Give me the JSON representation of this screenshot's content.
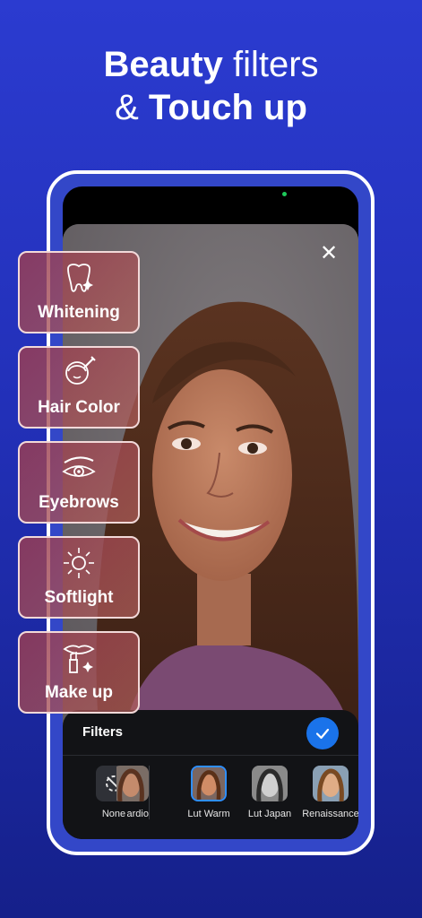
{
  "headline": {
    "line1_bold": "Beauty",
    "line1_light": "filters",
    "line2_light": "&",
    "line2_bold": "Touch up"
  },
  "features": [
    {
      "label": "Whitening",
      "icon": "tooth-sparkle-icon"
    },
    {
      "label": "Hair Color",
      "icon": "hair-brush-icon"
    },
    {
      "label": "Eyebrows",
      "icon": "eye-brow-icon"
    },
    {
      "label": "Softlight",
      "icon": "sun-light-icon"
    },
    {
      "label": "Make up",
      "icon": "lipstick-icon"
    }
  ],
  "editor": {
    "close_icon": "close-icon",
    "sheet_title": "Filters",
    "confirm_icon": "check-icon",
    "filters": [
      {
        "label": "None",
        "icon": "no-filter-icon"
      },
      {
        "label": "ardio",
        "icon": "portrait-thumb"
      },
      {
        "label": "Lut Warm",
        "icon": "portrait-thumb",
        "selected": true
      },
      {
        "label": "Lut Japan",
        "icon": "portrait-thumb-bw"
      },
      {
        "label": "Renaissance",
        "icon": "portrait-thumb"
      }
    ]
  },
  "colors": {
    "background_top": "#2b3bd0",
    "background_bottom": "#15208a",
    "accent": "#1a73ea",
    "card_fill": "#9b3c50"
  }
}
